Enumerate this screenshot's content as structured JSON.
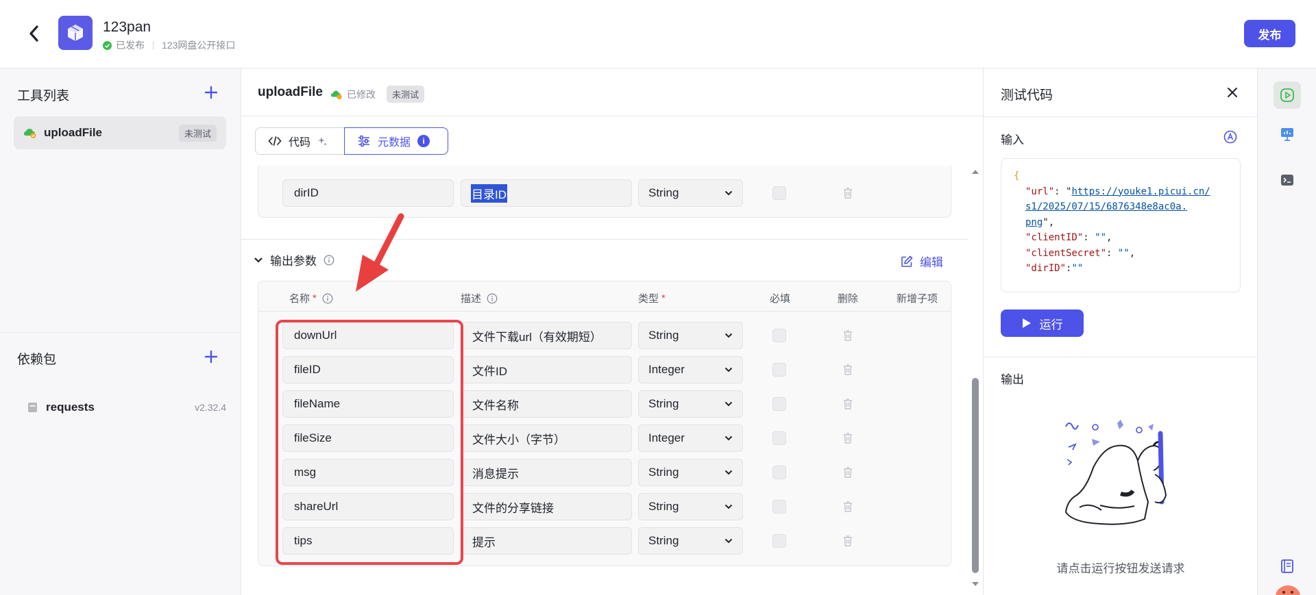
{
  "header": {
    "app_name": "123pan",
    "status": "已发布",
    "description": "123网盘公开接口",
    "publish_label": "发布",
    "colors": {
      "accent": "#4d53e8",
      "success": "#3fb950"
    }
  },
  "sidebar": {
    "tools_title": "工具列表",
    "tools": [
      {
        "label": "uploadFile",
        "badge": "未测试"
      }
    ],
    "deps_title": "依赖包",
    "deps": [
      {
        "name": "requests",
        "version": "v2.32.4"
      }
    ]
  },
  "editor": {
    "title": "uploadFile",
    "modified": "已修改",
    "test_badge": "未测试",
    "tabs": [
      {
        "label": "代码"
      },
      {
        "label": "元数据"
      }
    ],
    "input_rows": [
      {
        "name": "dirID",
        "desc": "目录ID",
        "type": "String"
      }
    ],
    "output_section": {
      "title": "输出参数",
      "edit_label": "编辑",
      "headers": {
        "name": "名称",
        "desc": "描述",
        "type": "类型",
        "required": "必填",
        "delete": "删除",
        "add_child": "新增子项"
      },
      "rows": [
        {
          "name": "downUrl",
          "desc": "文件下载url（有效期短）",
          "type": "String"
        },
        {
          "name": "fileID",
          "desc": "文件ID",
          "type": "Integer"
        },
        {
          "name": "fileName",
          "desc": "文件名称",
          "type": "String"
        },
        {
          "name": "fileSize",
          "desc": "文件大小（字节）",
          "type": "Integer"
        },
        {
          "name": "msg",
          "desc": "消息提示",
          "type": "String"
        },
        {
          "name": "shareUrl",
          "desc": "文件的分享链接",
          "type": "String"
        },
        {
          "name": "tips",
          "desc": "提示",
          "type": "String"
        }
      ]
    }
  },
  "test_panel": {
    "title": "测试代码",
    "input_label": "输入",
    "code": {
      "open": "{",
      "url_key": "\"url\"",
      "url_val_1": "https://youke1.picui.cn/",
      "url_val_2": "s1/2025/07/15/6876348e8ac0a.",
      "url_val_3": "png",
      "client_id_key": "\"clientID\"",
      "client_id_val": "\"\"",
      "client_secret_key": "\"clientSecret\"",
      "client_secret_val": "\"\"",
      "dir_id_key": "\"dirID\"",
      "dir_id_val": "\"\""
    },
    "run_label": "运行",
    "output_label": "输出",
    "empty_text": "请点击运行按钮发送请求"
  }
}
